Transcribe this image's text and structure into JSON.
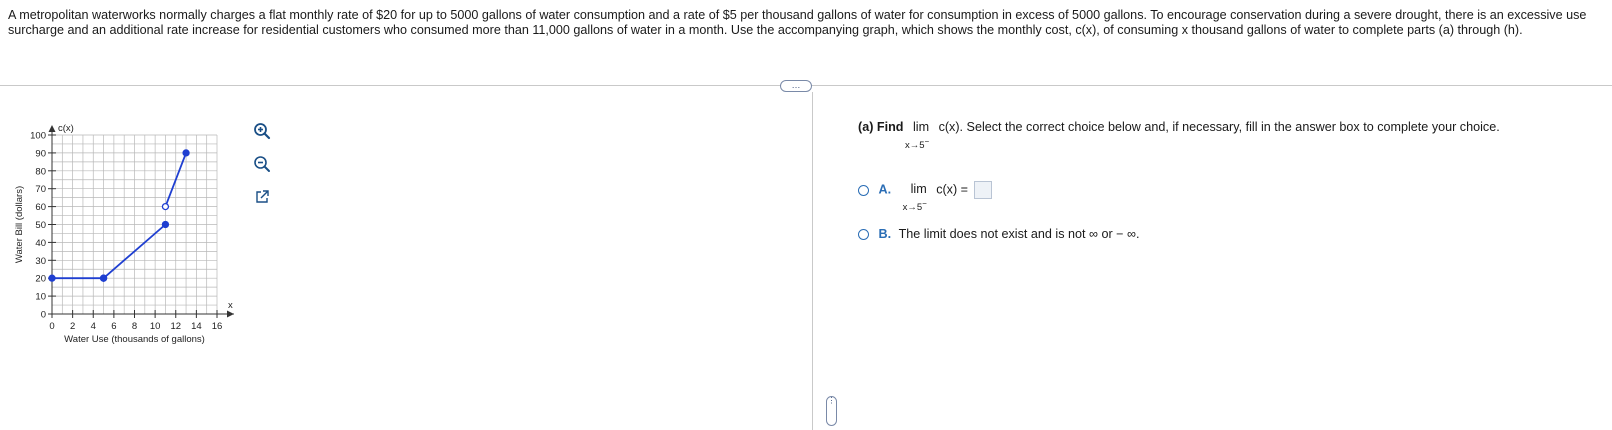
{
  "problem": {
    "text": "A metropolitan waterworks normally charges a flat monthly rate of $20 for up to 5000 gallons of water consumption and a rate of $5 per thousand gallons of water for consumption in excess of 5000 gallons. To encourage conservation during a severe drought, there is an excessive use surcharge and an additional rate increase for residential customers who consumed more than 11,000 gallons of water in a month. Use the accompanying graph, which shows the monthly cost, c(x), of consuming x thousand gallons of water to complete parts (a) through (h)."
  },
  "divider_handle": "…",
  "vertical_handle": "⋮",
  "tools": {
    "zoom_in": "zoom-in-icon",
    "zoom_out": "zoom-out-icon",
    "expand": "open-external-icon"
  },
  "chart_data": {
    "type": "line",
    "title": "",
    "function_label": "c(x)",
    "xlabel": "Water Use (thousands of gallons)",
    "ylabel": "Water Bill (dollars)",
    "x_axis_letter": "x",
    "xlim": [
      0,
      16
    ],
    "ylim": [
      0,
      100
    ],
    "x_ticks": [
      "0",
      "2",
      "4",
      "6",
      "8",
      "10",
      "12",
      "14",
      "16"
    ],
    "y_ticks": [
      "0",
      "10",
      "20",
      "30",
      "40",
      "50",
      "60",
      "70",
      "80",
      "90",
      "100"
    ],
    "grid": true,
    "segments": [
      {
        "points": [
          [
            0,
            20
          ],
          [
            5,
            20
          ]
        ],
        "start": "closed",
        "end": "closed"
      },
      {
        "points": [
          [
            5,
            20
          ],
          [
            11,
            50
          ]
        ],
        "start": "closed",
        "end": "closed"
      },
      {
        "points": [
          [
            11,
            60
          ],
          [
            13,
            90
          ]
        ],
        "start": "open",
        "end": "closed"
      }
    ],
    "color": "#1f3fd1"
  },
  "part_a": {
    "label": "(a) Find",
    "lim": "lim",
    "approach": "x→5",
    "sup": "−",
    "expr": "c(x).",
    "instructions": "Select the correct choice below and, if necessary, fill in the answer box to complete your choice."
  },
  "choices": {
    "a_letter": "A.",
    "a_lim": "lim",
    "a_approach": "x→5",
    "a_sup": "−",
    "a_expr": "c(x) =",
    "b_letter": "B.",
    "b_text": "The limit does not exist and is not ∞ or − ∞."
  }
}
